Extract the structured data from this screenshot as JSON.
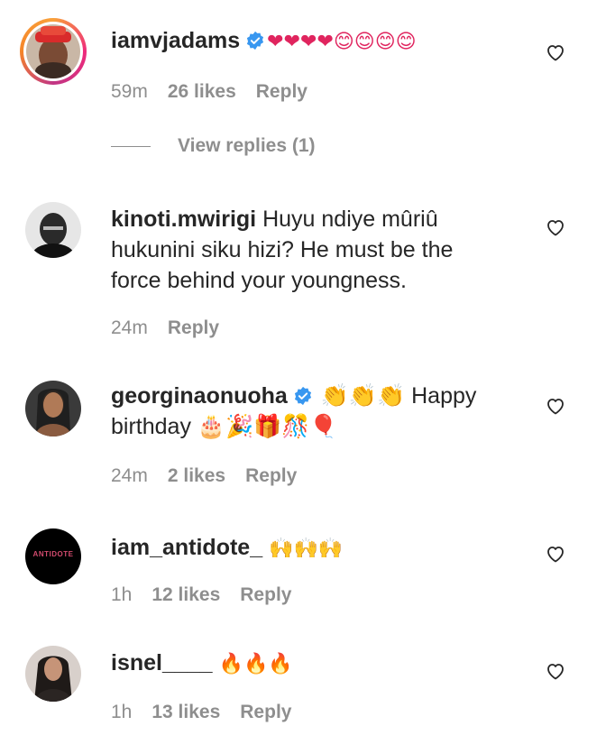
{
  "comments": [
    {
      "username": "iamvjadams",
      "verified": true,
      "text": "❤❤❤❤😊😊😊😊",
      "time": "59m",
      "likes": "26 likes",
      "reply": "Reply",
      "view_replies": "View replies (1)"
    },
    {
      "username": "kinoti.mwirigi",
      "verified": false,
      "text": "Huyu ndiye mûriû hukunini siku hizi? He must be the force behind your youngness.",
      "time": "24m",
      "likes": "",
      "reply": "Reply"
    },
    {
      "username": "georginaonuoha",
      "verified": true,
      "text": "👏👏👏 Happy birthday 🎂🎉🎁🎊🎈",
      "time": "24m",
      "likes": "2 likes",
      "reply": "Reply"
    },
    {
      "username": "iam_antidote_",
      "verified": false,
      "avatar_text": "ANTIDOTE",
      "text": "🙌🙌🙌",
      "time": "1h",
      "likes": "12 likes",
      "reply": "Reply"
    },
    {
      "username": "isnel____",
      "verified": false,
      "text": "🔥🔥🔥",
      "time": "1h",
      "likes": "13 likes",
      "reply": "Reply"
    }
  ],
  "colors": {
    "text": "#262626",
    "secondary": "#8e8e8e",
    "verified": "#3897f0",
    "heart_emoji": "#e0245e"
  },
  "icons": {
    "like": "heart-outline-icon",
    "verified": "verified-badge-icon"
  }
}
